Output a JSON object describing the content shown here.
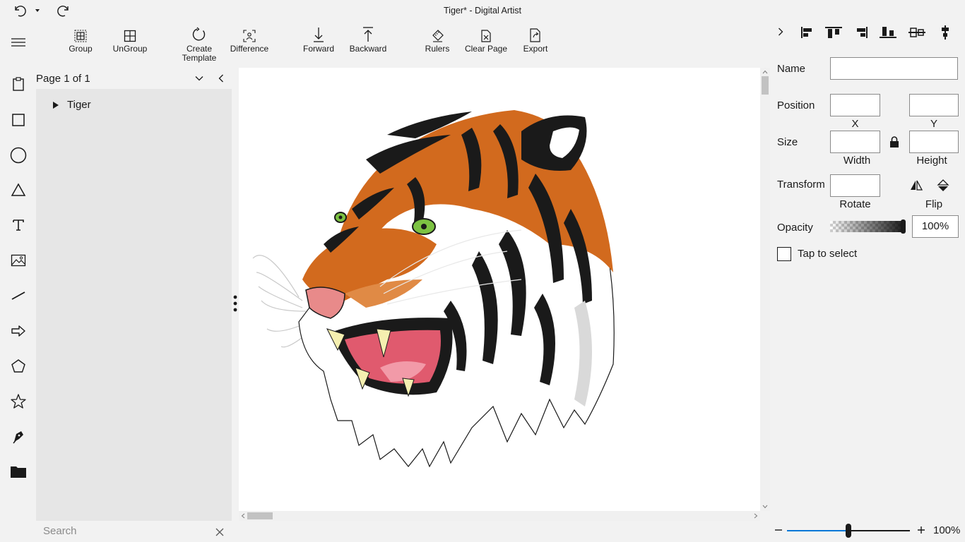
{
  "window": {
    "title": "Tiger*  -  Digital Artist"
  },
  "toolbar": {
    "group": "Group",
    "ungroup": "UnGroup",
    "create_template_line1": "Create",
    "create_template_line2": "Template",
    "difference": "Difference",
    "forward": "Forward",
    "backward": "Backward",
    "rulers": "Rulers",
    "clear_page": "Clear Page",
    "export": "Export"
  },
  "layers": {
    "page_label": "Page 1 of 1",
    "items": [
      {
        "label": "Tiger"
      }
    ]
  },
  "search": {
    "placeholder": "Search"
  },
  "properties": {
    "name_label": "Name",
    "position_label": "Position",
    "x_label": "X",
    "y_label": "Y",
    "size_label": "Size",
    "width_label": "Width",
    "height_label": "Height",
    "transform_label": "Transform",
    "rotate_label": "Rotate",
    "flip_label": "Flip",
    "opacity_label": "Opacity",
    "opacity_value": "100%",
    "tap_to_select": "Tap to select"
  },
  "zoom": {
    "value": "100%",
    "level": 0.5
  },
  "colors": {
    "accent": "#0078d7",
    "tiger_orange": "#d26a1e",
    "eye_green": "#7cc242"
  }
}
